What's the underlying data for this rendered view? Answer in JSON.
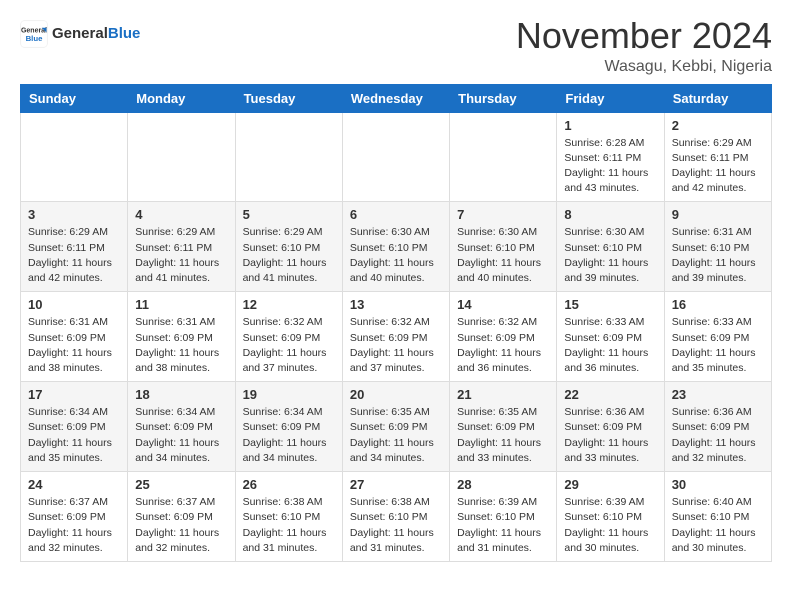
{
  "header": {
    "logo": {
      "general": "General",
      "blue": "Blue"
    },
    "title": "November 2024",
    "location": "Wasagu, Kebbi, Nigeria"
  },
  "weekdays": [
    "Sunday",
    "Monday",
    "Tuesday",
    "Wednesday",
    "Thursday",
    "Friday",
    "Saturday"
  ],
  "weeks": [
    [
      {
        "day": "",
        "info": ""
      },
      {
        "day": "",
        "info": ""
      },
      {
        "day": "",
        "info": ""
      },
      {
        "day": "",
        "info": ""
      },
      {
        "day": "",
        "info": ""
      },
      {
        "day": "1",
        "info": "Sunrise: 6:28 AM\nSunset: 6:11 PM\nDaylight: 11 hours and 43 minutes."
      },
      {
        "day": "2",
        "info": "Sunrise: 6:29 AM\nSunset: 6:11 PM\nDaylight: 11 hours and 42 minutes."
      }
    ],
    [
      {
        "day": "3",
        "info": "Sunrise: 6:29 AM\nSunset: 6:11 PM\nDaylight: 11 hours and 42 minutes."
      },
      {
        "day": "4",
        "info": "Sunrise: 6:29 AM\nSunset: 6:11 PM\nDaylight: 11 hours and 41 minutes."
      },
      {
        "day": "5",
        "info": "Sunrise: 6:29 AM\nSunset: 6:10 PM\nDaylight: 11 hours and 41 minutes."
      },
      {
        "day": "6",
        "info": "Sunrise: 6:30 AM\nSunset: 6:10 PM\nDaylight: 11 hours and 40 minutes."
      },
      {
        "day": "7",
        "info": "Sunrise: 6:30 AM\nSunset: 6:10 PM\nDaylight: 11 hours and 40 minutes."
      },
      {
        "day": "8",
        "info": "Sunrise: 6:30 AM\nSunset: 6:10 PM\nDaylight: 11 hours and 39 minutes."
      },
      {
        "day": "9",
        "info": "Sunrise: 6:31 AM\nSunset: 6:10 PM\nDaylight: 11 hours and 39 minutes."
      }
    ],
    [
      {
        "day": "10",
        "info": "Sunrise: 6:31 AM\nSunset: 6:09 PM\nDaylight: 11 hours and 38 minutes."
      },
      {
        "day": "11",
        "info": "Sunrise: 6:31 AM\nSunset: 6:09 PM\nDaylight: 11 hours and 38 minutes."
      },
      {
        "day": "12",
        "info": "Sunrise: 6:32 AM\nSunset: 6:09 PM\nDaylight: 11 hours and 37 minutes."
      },
      {
        "day": "13",
        "info": "Sunrise: 6:32 AM\nSunset: 6:09 PM\nDaylight: 11 hours and 37 minutes."
      },
      {
        "day": "14",
        "info": "Sunrise: 6:32 AM\nSunset: 6:09 PM\nDaylight: 11 hours and 36 minutes."
      },
      {
        "day": "15",
        "info": "Sunrise: 6:33 AM\nSunset: 6:09 PM\nDaylight: 11 hours and 36 minutes."
      },
      {
        "day": "16",
        "info": "Sunrise: 6:33 AM\nSunset: 6:09 PM\nDaylight: 11 hours and 35 minutes."
      }
    ],
    [
      {
        "day": "17",
        "info": "Sunrise: 6:34 AM\nSunset: 6:09 PM\nDaylight: 11 hours and 35 minutes."
      },
      {
        "day": "18",
        "info": "Sunrise: 6:34 AM\nSunset: 6:09 PM\nDaylight: 11 hours and 34 minutes."
      },
      {
        "day": "19",
        "info": "Sunrise: 6:34 AM\nSunset: 6:09 PM\nDaylight: 11 hours and 34 minutes."
      },
      {
        "day": "20",
        "info": "Sunrise: 6:35 AM\nSunset: 6:09 PM\nDaylight: 11 hours and 34 minutes."
      },
      {
        "day": "21",
        "info": "Sunrise: 6:35 AM\nSunset: 6:09 PM\nDaylight: 11 hours and 33 minutes."
      },
      {
        "day": "22",
        "info": "Sunrise: 6:36 AM\nSunset: 6:09 PM\nDaylight: 11 hours and 33 minutes."
      },
      {
        "day": "23",
        "info": "Sunrise: 6:36 AM\nSunset: 6:09 PM\nDaylight: 11 hours and 32 minutes."
      }
    ],
    [
      {
        "day": "24",
        "info": "Sunrise: 6:37 AM\nSunset: 6:09 PM\nDaylight: 11 hours and 32 minutes."
      },
      {
        "day": "25",
        "info": "Sunrise: 6:37 AM\nSunset: 6:09 PM\nDaylight: 11 hours and 32 minutes."
      },
      {
        "day": "26",
        "info": "Sunrise: 6:38 AM\nSunset: 6:10 PM\nDaylight: 11 hours and 31 minutes."
      },
      {
        "day": "27",
        "info": "Sunrise: 6:38 AM\nSunset: 6:10 PM\nDaylight: 11 hours and 31 minutes."
      },
      {
        "day": "28",
        "info": "Sunrise: 6:39 AM\nSunset: 6:10 PM\nDaylight: 11 hours and 31 minutes."
      },
      {
        "day": "29",
        "info": "Sunrise: 6:39 AM\nSunset: 6:10 PM\nDaylight: 11 hours and 30 minutes."
      },
      {
        "day": "30",
        "info": "Sunrise: 6:40 AM\nSunset: 6:10 PM\nDaylight: 11 hours and 30 minutes."
      }
    ]
  ]
}
